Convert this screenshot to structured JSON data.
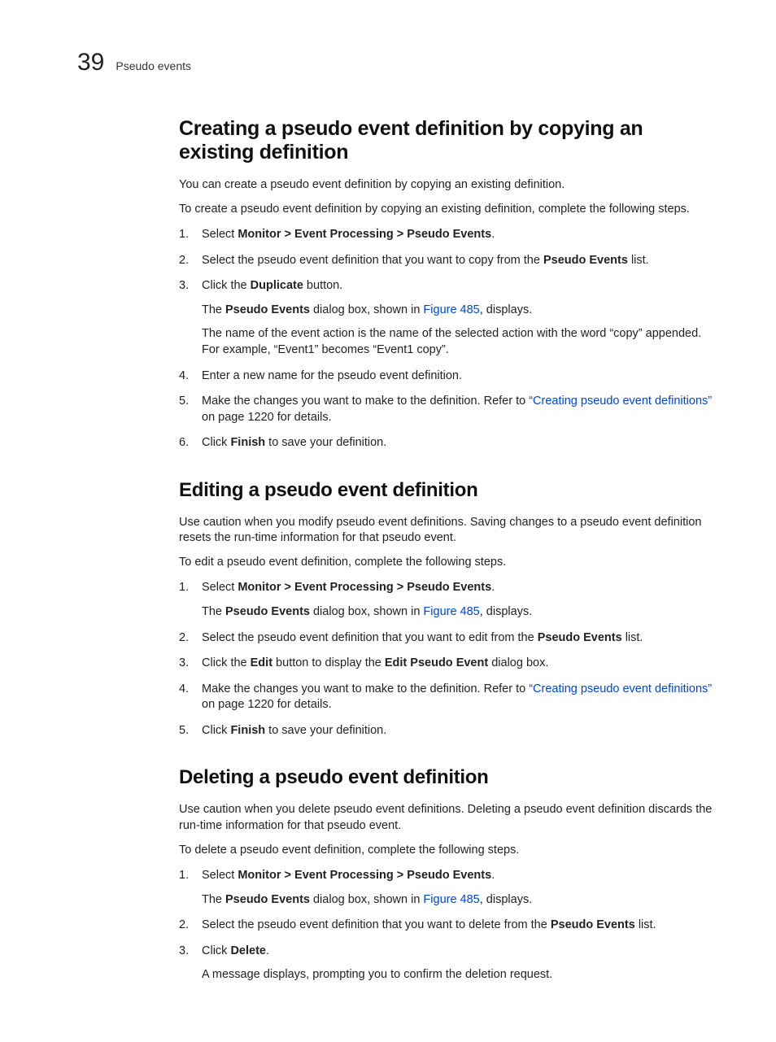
{
  "header": {
    "chapter_number": "39",
    "chapter_title": "Pseudo events"
  },
  "s1": {
    "title": "Creating a pseudo event definition by copying an existing definition",
    "p1": "You can create a pseudo event definition by copying an existing definition.",
    "p2": "To create a pseudo event definition by copying an existing definition, complete the following steps.",
    "li1_a": "Select ",
    "li1_b": "Monitor > Event Processing > Pseudo Events",
    "li1_c": ".",
    "li2_a": "Select the pseudo event definition that you want to copy from the ",
    "li2_b": "Pseudo Events",
    "li2_c": " list.",
    "li3_a": "Click the ",
    "li3_b": "Duplicate",
    "li3_c": " button.",
    "li3_sub1_a": "The ",
    "li3_sub1_b": "Pseudo Events",
    "li3_sub1_c": " dialog box, shown in ",
    "li3_sub1_link": "Figure 485",
    "li3_sub1_d": ", displays.",
    "li3_sub2": "The name of the event action is the name of the selected action with the word “copy” appended. For example, “Event1” becomes “Event1 copy”.",
    "li4": "Enter a new name for the pseudo event definition.",
    "li5_a": "Make the changes you want to make to the definition. Refer to ",
    "li5_link": "“Creating pseudo event definitions”",
    "li5_b": " on page 1220 for details.",
    "li6_a": "Click ",
    "li6_b": "Finish",
    "li6_c": " to save your definition."
  },
  "s2": {
    "title": "Editing a pseudo event definition",
    "p1": "Use caution when you modify pseudo event definitions. Saving changes to a pseudo event definition resets the run-time information for that pseudo event.",
    "p2": "To edit a pseudo event definition, complete the following steps.",
    "li1_a": "Select ",
    "li1_b": "Monitor > Event Processing > Pseudo Events",
    "li1_c": ".",
    "li1_sub_a": "The ",
    "li1_sub_b": "Pseudo Events",
    "li1_sub_c": " dialog box, shown in ",
    "li1_sub_link": "Figure 485",
    "li1_sub_d": ", displays.",
    "li2_a": "Select the pseudo event definition that you want to edit from the ",
    "li2_b": "Pseudo Events",
    "li2_c": " list.",
    "li3_a": "Click the ",
    "li3_b": "Edit",
    "li3_c": " button to display the ",
    "li3_d": "Edit Pseudo Event",
    "li3_e": " dialog box.",
    "li4_a": "Make the changes you want to make to the definition. Refer to ",
    "li4_link": "“Creating pseudo event definitions”",
    "li4_b": " on page 1220 for details.",
    "li5_a": "Click ",
    "li5_b": "Finish",
    "li5_c": " to save your definition."
  },
  "s3": {
    "title": "Deleting a pseudo event definition",
    "p1": "Use caution when you delete pseudo event definitions. Deleting a pseudo event definition discards the run-time information for that pseudo event.",
    "p2": "To delete a pseudo event definition, complete the following steps.",
    "li1_a": "Select ",
    "li1_b": "Monitor > Event Processing > Pseudo Events",
    "li1_c": ".",
    "li1_sub_a": "The ",
    "li1_sub_b": "Pseudo Events",
    "li1_sub_c": " dialog box, shown in ",
    "li1_sub_link": "Figure 485",
    "li1_sub_d": ", displays.",
    "li2_a": "Select the pseudo event definition that you want to delete from the ",
    "li2_b": "Pseudo Events",
    "li2_c": " list.",
    "li3_a": "Click ",
    "li3_b": "Delete",
    "li3_c": ".",
    "li3_sub": "A message displays, prompting you to confirm the deletion request."
  }
}
